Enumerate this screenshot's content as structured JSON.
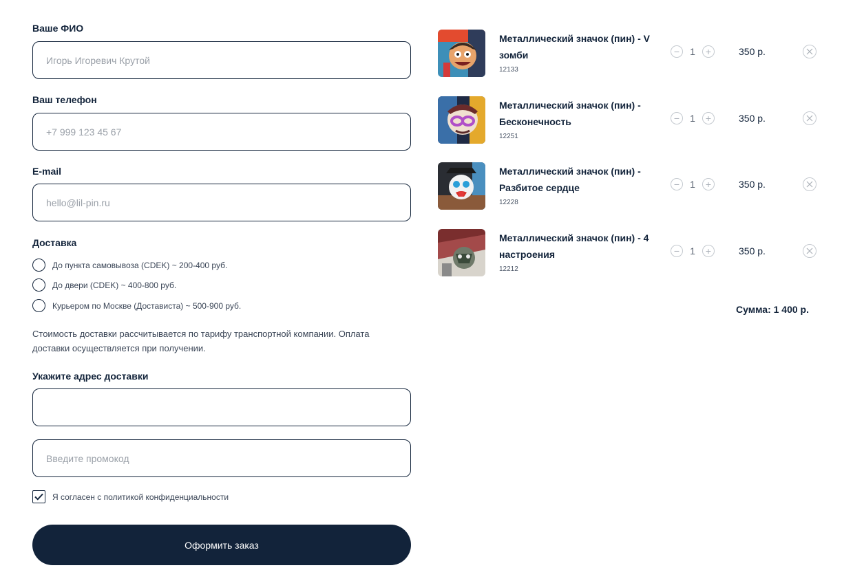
{
  "form": {
    "name": {
      "label": "Ваше ФИО",
      "placeholder": "Игорь Игоревич Крутой",
      "value": ""
    },
    "phone": {
      "label": "Ваш телефон",
      "placeholder": "+7 999 123 45 67",
      "value": ""
    },
    "email": {
      "label": "E-mail",
      "placeholder": "hello@lil-pin.ru",
      "value": ""
    },
    "delivery": {
      "label": "Доставка",
      "options": [
        "До пункта самовывоза (CDEK) ~ 200-400 руб.",
        "До двери (CDEK) ~ 400-800 руб.",
        "Курьером по Москве (Достависта) ~ 500-900 руб."
      ],
      "note": "Стоимость доставки рассчитывается по тарифу транспортной компании. Оплата доставки осуществляется при получении."
    },
    "address": {
      "label": "Укажите адрес доставки",
      "placeholder": "",
      "value": ""
    },
    "promo": {
      "placeholder": "Введите промокод",
      "value": ""
    },
    "consent": {
      "label": "Я согласен с политикой конфиденциальности",
      "checked": true
    },
    "submit_label": "Оформить заказ"
  },
  "cart": {
    "items": [
      {
        "title": "Металлический значок (пин) - V зомби",
        "sku": "12133",
        "qty": "1",
        "price": "350 р.",
        "icon": "zombie-pin-image"
      },
      {
        "title": "Металлический значок (пин) - Бесконечность",
        "sku": "12251",
        "qty": "1",
        "price": "350 р.",
        "icon": "infinity-pin-image"
      },
      {
        "title": "Металлический значок (пин) - Разбитое сердце",
        "sku": "12228",
        "qty": "1",
        "price": "350 р.",
        "icon": "broken-heart-pin-image"
      },
      {
        "title": "Металлический значок (пин) - 4 настроения",
        "sku": "12212",
        "qty": "1",
        "price": "350 р.",
        "icon": "four-moods-pin-image"
      }
    ],
    "total": "Сумма: 1 400 р."
  },
  "colors": {
    "primary": "#12233a",
    "muted": "#9aa0a8",
    "border_light": "#c4c9cf",
    "background": "#ffffff"
  }
}
